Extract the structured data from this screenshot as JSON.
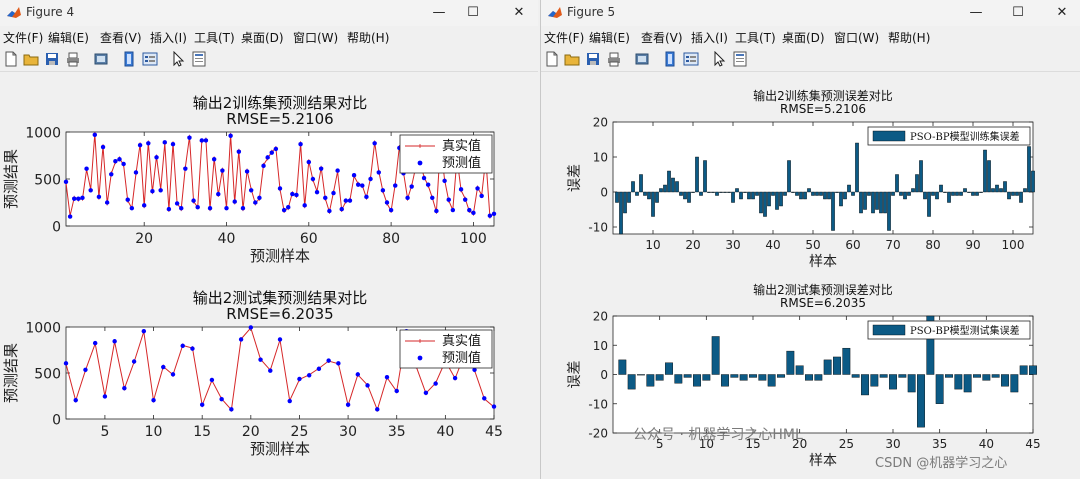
{
  "fig4": {
    "title": "Figure 4",
    "menu": [
      "文件(F)",
      "编辑(E)",
      "查看(V)",
      "插入(I)",
      "工具(T)",
      "桌面(D)",
      "窗口(W)",
      "帮助(H)"
    ]
  },
  "fig5": {
    "title": "Figure 5",
    "menu": [
      "文件(F)",
      "编辑(E)",
      "查看(V)",
      "插入(I)",
      "工具(T)",
      "桌面(D)",
      "窗口(W)",
      "帮助(H)"
    ]
  },
  "window_controls": {
    "minimize": "—",
    "maximize": "☐",
    "close": "✕"
  },
  "icons": [
    "new-file-icon",
    "open-folder-icon",
    "save-icon",
    "print-icon",
    "print-preview-icon",
    "link-plot-icon",
    "insert-legend-icon",
    "pointer-icon",
    "property-inspector-icon"
  ],
  "colors": {
    "real": "#d62728",
    "pred": "#0000ff",
    "bar_fill": "#0c5a85",
    "bar_edge": "#000000"
  },
  "watermarks": {
    "wechat": "公众号 · 机器学习之心HML",
    "csdn": "CSDN @机器学习之心"
  },
  "chart_data": [
    {
      "type": "line",
      "title": "输出2训练集预测结果对比",
      "subtitle": "RMSE=5.2106",
      "xlabel": "预测样本",
      "ylabel": "预测结果",
      "xlim": [
        1,
        105
      ],
      "ylim": [
        0,
        1000
      ],
      "xticks": [
        20,
        40,
        60,
        80,
        100
      ],
      "yticks": [
        0,
        500,
        1000
      ],
      "legend_position": "top-right",
      "series": [
        {
          "name": "真实值",
          "style": "line-plus",
          "values": [
            460,
            110,
            300,
            280,
            290,
            600,
            390,
            980,
            300,
            850,
            240,
            560,
            680,
            720,
            650,
            270,
            190,
            560,
            870,
            210,
            890,
            360,
            740,
            390,
            880,
            170,
            880,
            240,
            180,
            620,
            950,
            260,
            200,
            900,
            920,
            180,
            720,
            330,
            600,
            190,
            970,
            250,
            800,
            180,
            590,
            390,
            240,
            290,
            650,
            720,
            790,
            830,
            390,
            160,
            190,
            350,
            320,
            880,
            210,
            690,
            490,
            370,
            620,
            290,
            150,
            360,
            580,
            170,
            260,
            280,
            530,
            450,
            430,
            300,
            510,
            890,
            580,
            370,
            240,
            160,
            440,
            840,
            570,
            290,
            430,
            630,
            700,
            520,
            430,
            300,
            150,
            880,
            490,
            270,
            170,
            720,
            380,
            290,
            160,
            130,
            410,
            330,
            720,
            100,
            130
          ]
        },
        {
          "name": "预测值",
          "style": "dots",
          "values": [
            470,
            100,
            290,
            290,
            300,
            610,
            380,
            970,
            310,
            840,
            250,
            550,
            690,
            710,
            660,
            280,
            190,
            570,
            860,
            220,
            880,
            370,
            730,
            380,
            890,
            180,
            870,
            240,
            190,
            610,
            940,
            270,
            200,
            910,
            910,
            190,
            710,
            340,
            590,
            190,
            960,
            260,
            790,
            190,
            580,
            380,
            250,
            300,
            640,
            730,
            780,
            820,
            400,
            170,
            200,
            340,
            330,
            870,
            220,
            680,
            500,
            360,
            610,
            300,
            160,
            350,
            590,
            180,
            270,
            270,
            540,
            440,
            430,
            310,
            500,
            880,
            570,
            380,
            250,
            170,
            430,
            830,
            560,
            300,
            420,
            620,
            690,
            510,
            440,
            300,
            160,
            870,
            480,
            280,
            170,
            710,
            390,
            280,
            170,
            140,
            400,
            320,
            710,
            110,
            130
          ]
        }
      ]
    },
    {
      "type": "line",
      "title": "输出2测试集预测结果对比",
      "subtitle": "RMSE=6.2035",
      "xlabel": "预测样本",
      "ylabel": "预测结果",
      "xlim": [
        1,
        45
      ],
      "ylim": [
        0,
        1000
      ],
      "xticks": [
        5,
        10,
        15,
        20,
        25,
        30,
        35,
        40,
        45
      ],
      "yticks": [
        0,
        500,
        1000
      ],
      "legend_position": "top-right",
      "series": [
        {
          "name": "真实值",
          "style": "line-plus",
          "values": [
            600,
            200,
            530,
            820,
            250,
            840,
            330,
            620,
            950,
            200,
            570,
            480,
            800,
            770,
            150,
            420,
            220,
            100,
            870,
            990,
            650,
            530,
            860,
            200,
            430,
            480,
            550,
            630,
            600,
            150,
            480,
            370,
            100,
            450,
            300,
            950,
            570,
            280,
            390,
            630,
            440,
            710,
            530,
            220,
            130
          ]
        },
        {
          "name": "预测值",
          "style": "dots",
          "values": [
            605,
            205,
            535,
            825,
            245,
            845,
            335,
            625,
            955,
            205,
            565,
            485,
            795,
            765,
            155,
            425,
            215,
            105,
            865,
            995,
            645,
            525,
            865,
            195,
            435,
            475,
            545,
            635,
            605,
            155,
            485,
            365,
            105,
            455,
            305,
            955,
            575,
            285,
            385,
            625,
            445,
            705,
            535,
            225,
            135
          ]
        }
      ]
    },
    {
      "type": "bar",
      "title": "输出2训练集预测误差对比",
      "subtitle": "RMSE=5.2106",
      "xlabel": "样本",
      "ylabel": "误差",
      "xlim": [
        0,
        105
      ],
      "ylim": [
        -12,
        20
      ],
      "xticks": [
        10,
        20,
        30,
        40,
        50,
        60,
        70,
        80,
        90,
        100
      ],
      "yticks": [
        -10,
        0,
        10,
        20
      ],
      "legend_position": "top-right",
      "series": [
        {
          "name": "PSO-BP模型训练集误差",
          "values": [
            -3,
            -12,
            -6,
            -3,
            3,
            -1,
            5,
            -1,
            -2,
            -7,
            -3,
            1,
            2,
            6,
            4,
            3,
            -1,
            -2,
            -3,
            0,
            10,
            -1,
            9,
            0,
            0,
            -1,
            0,
            0,
            0,
            -3,
            1,
            -2,
            0,
            -2,
            -2,
            -1,
            -6,
            -7,
            -4,
            -1,
            -5,
            -4,
            -1,
            9,
            0,
            -1,
            -2,
            -2,
            1,
            -1,
            -1,
            -1,
            -2,
            -2,
            -11,
            0,
            -4,
            -2,
            2,
            -1,
            14,
            -6,
            -5,
            -1,
            -6,
            -5,
            -6,
            -6,
            -11,
            -1,
            5,
            -1,
            -2,
            -1,
            1,
            5,
            9,
            -2,
            -7,
            -1,
            -2,
            2,
            0,
            -3,
            -1,
            -1,
            -1,
            1,
            0,
            -1,
            -1,
            0,
            12,
            9,
            1,
            2,
            1,
            3,
            -2,
            -1,
            -1,
            -3,
            1,
            13,
            6
          ]
        }
      ]
    },
    {
      "type": "bar",
      "title": "输出2测试集预测误差对比",
      "subtitle": "RMSE=6.2035",
      "xlabel": "样本",
      "ylabel": "误差",
      "xlim": [
        0,
        45
      ],
      "ylim": [
        -20,
        20
      ],
      "xticks": [
        5,
        10,
        15,
        20,
        25,
        30,
        35,
        40,
        45
      ],
      "yticks": [
        -20,
        -10,
        0,
        10,
        20
      ],
      "legend_position": "top-right",
      "series": [
        {
          "name": "PSO-BP模型测试集误差",
          "values": [
            5,
            -5,
            0,
            -4,
            -2,
            4,
            -3,
            -1,
            -4,
            -2,
            13,
            -4,
            -1,
            -2,
            -1,
            -2,
            -4,
            -1,
            8,
            3,
            -2,
            -2,
            5,
            6,
            9,
            -1,
            -7,
            -4,
            -1,
            -5,
            -1,
            -6,
            -18,
            20,
            -10,
            -1,
            -5,
            -6,
            -1,
            -2,
            -1,
            -4,
            -6,
            3,
            3
          ]
        }
      ]
    }
  ]
}
